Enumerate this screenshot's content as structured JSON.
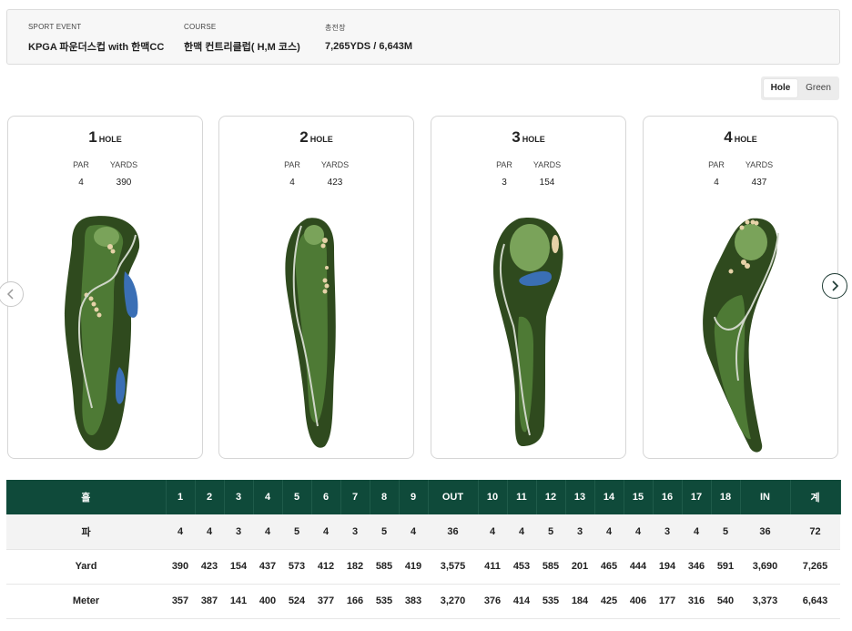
{
  "event": {
    "sport_event_label": "SPORT EVENT",
    "sport_event_value": "KPGA 파운더스컵 with 한맥CC",
    "course_label": "COURSE",
    "course_value": "한맥 컨트리클럽( H,M 코스)",
    "total_label": "총전장",
    "total_value": "7,265YDS / 6,643M"
  },
  "view_toggle": {
    "hole_label": "Hole",
    "green_label": "Green",
    "active": "Hole"
  },
  "holes": [
    {
      "number": "1",
      "suffix": "HOLE",
      "par_label": "PAR",
      "yards_label": "YARDS",
      "par": "4",
      "yards": "390"
    },
    {
      "number": "2",
      "suffix": "HOLE",
      "par_label": "PAR",
      "yards_label": "YARDS",
      "par": "4",
      "yards": "423"
    },
    {
      "number": "3",
      "suffix": "HOLE",
      "par_label": "PAR",
      "yards_label": "YARDS",
      "par": "3",
      "yards": "154"
    },
    {
      "number": "4",
      "suffix": "HOLE",
      "par_label": "PAR",
      "yards_label": "YARDS",
      "par": "4",
      "yards": "437"
    }
  ],
  "nav": {
    "prev_icon": "chevron-left-icon",
    "next_icon": "chevron-right-icon"
  },
  "colors": {
    "header_green": "#0f4a3a",
    "rough": "#2f4a1e",
    "fairway": "#4e7a35",
    "water": "#3a6fb5",
    "bunker": "#e6d2a8"
  },
  "scorecard": {
    "headers": [
      "홀",
      "1",
      "2",
      "3",
      "4",
      "5",
      "6",
      "7",
      "8",
      "9",
      "OUT",
      "10",
      "11",
      "12",
      "13",
      "14",
      "15",
      "16",
      "17",
      "18",
      "IN",
      "계"
    ],
    "rows": [
      {
        "label": "파",
        "values": [
          "4",
          "4",
          "3",
          "4",
          "5",
          "4",
          "3",
          "5",
          "4",
          "36",
          "4",
          "4",
          "5",
          "3",
          "4",
          "4",
          "3",
          "4",
          "5",
          "36",
          "72"
        ]
      },
      {
        "label": "Yard",
        "values": [
          "390",
          "423",
          "154",
          "437",
          "573",
          "412",
          "182",
          "585",
          "419",
          "3,575",
          "411",
          "453",
          "585",
          "201",
          "465",
          "444",
          "194",
          "346",
          "591",
          "3,690",
          "7,265"
        ]
      },
      {
        "label": "Meter",
        "values": [
          "357",
          "387",
          "141",
          "400",
          "524",
          "377",
          "166",
          "535",
          "383",
          "3,270",
          "376",
          "414",
          "535",
          "184",
          "425",
          "406",
          "177",
          "316",
          "540",
          "3,373",
          "6,643"
        ]
      }
    ]
  }
}
